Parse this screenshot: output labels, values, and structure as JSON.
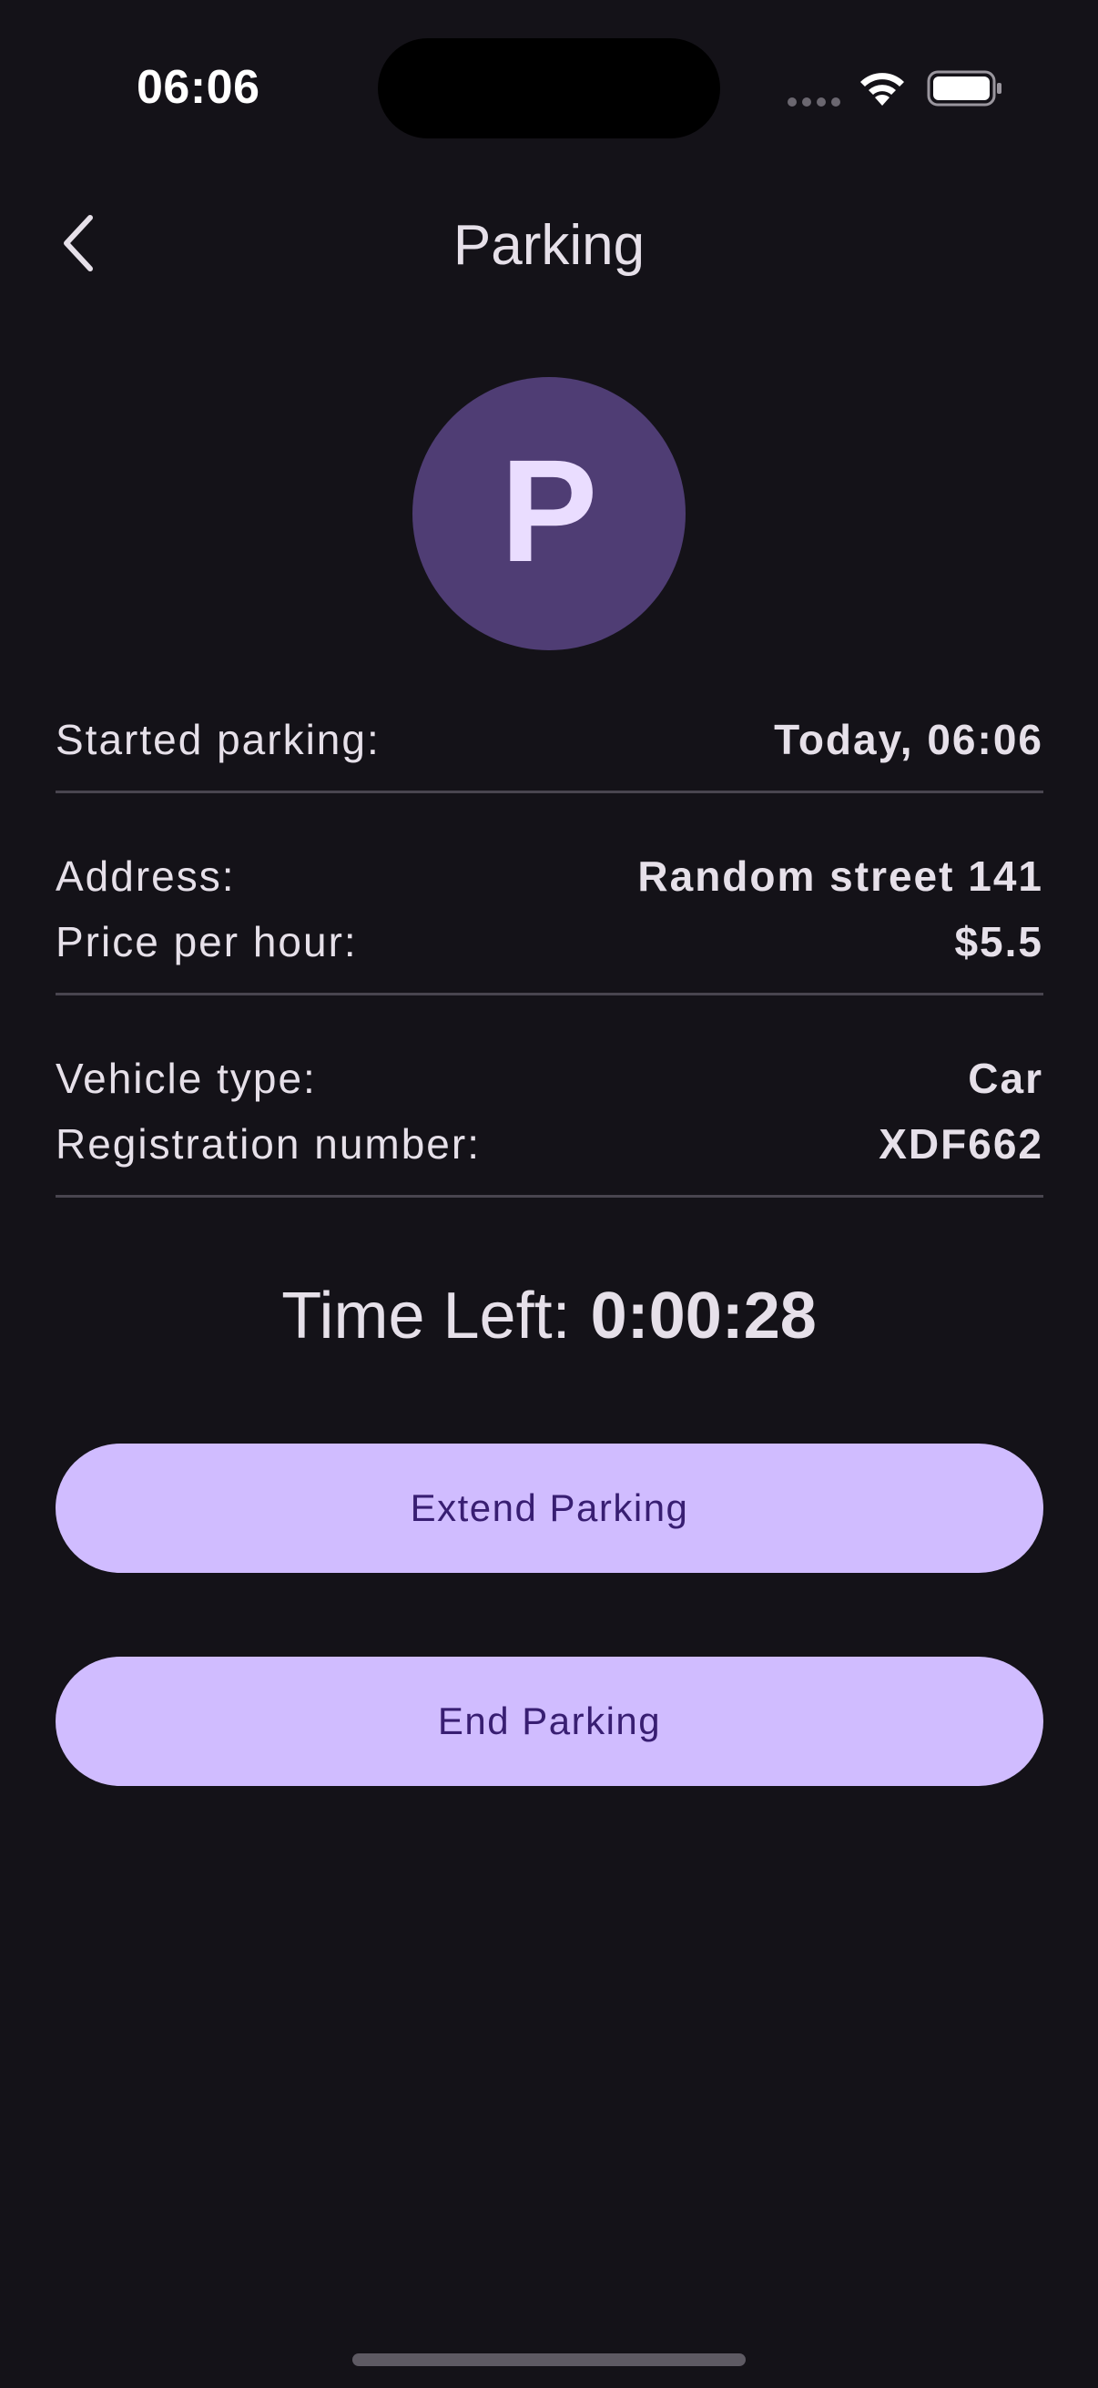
{
  "status_bar": {
    "time": "06:06",
    "icons": [
      "signal-icon",
      "wifi-icon",
      "battery-icon"
    ]
  },
  "header": {
    "title": "Parking",
    "back_icon": "chevron-left-icon"
  },
  "avatar": {
    "letter": "P",
    "background": "#4F3D74",
    "foreground": "#EADDFF"
  },
  "details": {
    "started": {
      "label": "Started parking:",
      "value": "Today, 06:06"
    },
    "address": {
      "label": "Address:",
      "value": "Random street 141"
    },
    "price": {
      "label": "Price per hour:",
      "value": "$5.5"
    },
    "vehicle_type": {
      "label": "Vehicle type:",
      "value": "Car"
    },
    "registration": {
      "label": "Registration number:",
      "value": "XDF662"
    }
  },
  "timer": {
    "label": "Time Left:",
    "value": "0:00:28"
  },
  "actions": {
    "extend_label": "Extend Parking",
    "end_label": "End Parking"
  },
  "colors": {
    "background": "#141218",
    "button": "#D0BCFF",
    "button_text": "#381E72",
    "divider": "#49454F"
  }
}
